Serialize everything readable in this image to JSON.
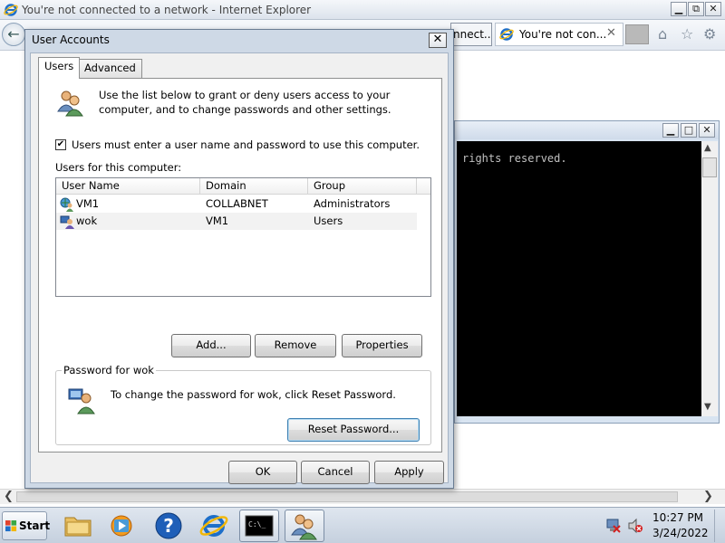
{
  "ie": {
    "title": "You're not connected to a network - Internet Explorer",
    "tab1_label": "nnect...",
    "tab2_label": "You're not con...",
    "tab_close": "✕",
    "back_glyph": "←",
    "home_glyph": "⌂",
    "star_glyph": "☆",
    "gear_glyph": "⚙"
  },
  "window_controls": {
    "minimize": "▁",
    "maximize": "□",
    "restore": "⧉",
    "close": "✕"
  },
  "console": {
    "text": "rights reserved."
  },
  "dialog": {
    "title": "User Accounts",
    "close": "✕",
    "tabs": [
      {
        "label": "Users"
      },
      {
        "label": "Advanced"
      }
    ],
    "intro": "Use the list below to grant or deny users access to your computer, and to change passwords and other settings.",
    "checkbox": {
      "label": "Users must enter a user name and password to use this computer.",
      "checked": true,
      "mark": "✔"
    },
    "users_label": "Users for this computer:",
    "columns": [
      "User Name",
      "Domain",
      "Group"
    ],
    "rows": [
      {
        "user": "VM1",
        "domain": "COLLABNET",
        "group": "Administrators"
      },
      {
        "user": "wok",
        "domain": "VM1",
        "group": "Users"
      }
    ],
    "buttons": {
      "add": "Add...",
      "remove": "Remove",
      "properties": "Properties"
    },
    "password_group": {
      "legend": "Password for wok",
      "text": "To change the password for wok, click Reset Password.",
      "reset_button": "Reset Password..."
    },
    "footer": {
      "ok": "OK",
      "cancel": "Cancel",
      "apply": "Apply"
    }
  },
  "taskbar": {
    "start_label": "Start",
    "items": [
      {
        "name": "file-explorer"
      },
      {
        "name": "media-player"
      },
      {
        "name": "help-support"
      },
      {
        "name": "internet-explorer"
      },
      {
        "name": "command-prompt",
        "label": "C:\\_"
      },
      {
        "name": "user-accounts"
      }
    ],
    "clock": {
      "time": "10:27 PM",
      "date": "3/24/2022"
    }
  },
  "colors": {
    "dialog_frame": "#ced9e6",
    "console_bg": "#000000",
    "taskbar": "#c5d0de",
    "ie_blue": "#1e6fc9"
  }
}
